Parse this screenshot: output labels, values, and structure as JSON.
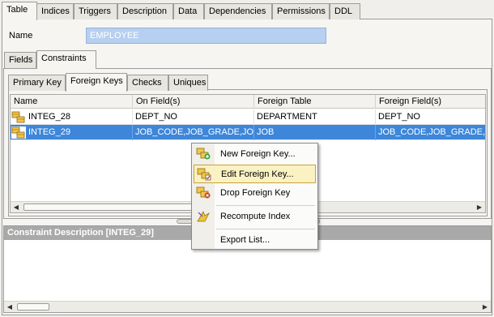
{
  "top_tabs": [
    {
      "label": "Table",
      "active": true
    },
    {
      "label": "Indices"
    },
    {
      "label": "Triggers"
    },
    {
      "label": "Description"
    },
    {
      "label": "Data"
    },
    {
      "label": "Dependencies"
    },
    {
      "label": "Permissions"
    },
    {
      "label": "DDL"
    }
  ],
  "name_field": {
    "label": "Name",
    "value": "EMPLOYEE"
  },
  "section_tabs": [
    {
      "label": "Fields"
    },
    {
      "label": "Constraints",
      "active": true
    }
  ],
  "constraint_tabs": [
    {
      "label": "Primary Key"
    },
    {
      "label": "Foreign Keys",
      "active": true
    },
    {
      "label": "Checks"
    },
    {
      "label": "Uniques"
    }
  ],
  "grid": {
    "columns": [
      "Name",
      "On Field(s)",
      "Foreign Table",
      "Foreign Field(s)"
    ],
    "rows": [
      {
        "name": "INTEG_28",
        "on_fields": "DEPT_NO",
        "foreign_table": "DEPARTMENT",
        "foreign_fields": "DEPT_NO",
        "selected": false
      },
      {
        "name": "INTEG_29",
        "on_fields": "JOB_CODE,JOB_GRADE,JOB_COUNTRY",
        "foreign_table": "JOB",
        "foreign_fields": "JOB_CODE,JOB_GRADE,JOB_COUNTRY",
        "selected": true
      }
    ]
  },
  "description": {
    "header": "Constraint Description [INTEG_29]"
  },
  "context_menu": [
    {
      "label": "New Foreign Key...",
      "icon": "new-foreign-key-icon"
    },
    {
      "label": "Edit Foreign Key...",
      "icon": "edit-foreign-key-icon",
      "highlighted": true
    },
    {
      "label": "Drop Foreign Key",
      "icon": "drop-foreign-key-icon"
    },
    {
      "label": "Recompute Index",
      "icon": "recompute-index-icon"
    },
    {
      "label": "Export List...",
      "icon": ""
    }
  ],
  "colors": {
    "selection": "#3d86d9",
    "menu_highlight": "#fbf2c4",
    "name_input_bg": "#b7cff0",
    "description_header": "#a9a9a9"
  }
}
